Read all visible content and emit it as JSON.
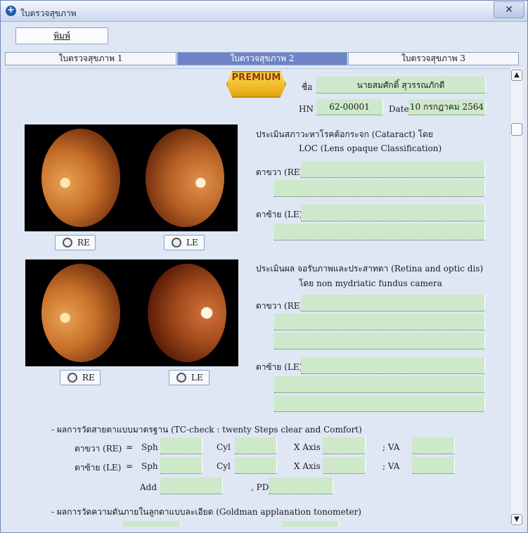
{
  "window": {
    "title": "ใบตรวจสุขภาพ",
    "close_label": "✕"
  },
  "toolbar": {
    "print_label": "พิมพ์"
  },
  "tabs": [
    {
      "label": "ใบตรวจสุขภาพ 1",
      "active": false
    },
    {
      "label": "ใบตรวจสุขภาพ 2",
      "active": true
    },
    {
      "label": "ใบตรวจสุขภาพ 3",
      "active": false
    }
  ],
  "badge": {
    "text": "PREMIUM"
  },
  "patient": {
    "name_label": "ชื่อ",
    "name": "นายสมศักดิ์ สุวรรณภักดี",
    "hn_label": "HN",
    "hn": "62-00001",
    "date_label": "Date",
    "date": "10 กรกฎาคม 2564"
  },
  "cataract": {
    "heading": "ประเมินสภาวะหาโรคต้อกระจก (Cataract) โดย",
    "subheading": "LOC (Lens opaque Classification)",
    "right_label": "ตาขวา (RE)",
    "left_label": "ตาซ้าย (LE)",
    "right_lines": [
      "",
      ""
    ],
    "left_lines": [
      "",
      ""
    ],
    "btn_re": "RE",
    "btn_le": "LE"
  },
  "retina": {
    "heading": "ประเมินผล จอรับภาพและประสาทตา (Retina and optic dis)",
    "subheading": "โดย  non mydriatic fundus camera",
    "right_label": "ตาขวา (RE)",
    "left_label": "ตาซ้าย (LE)",
    "right_lines": [
      "",
      "",
      ""
    ],
    "left_lines": [
      "",
      "",
      ""
    ],
    "btn_re": "RE",
    "btn_le": "LE"
  },
  "vision": {
    "heading": "- ผลการวัดสายตาแบบมาตรฐาน (TC-check : twenty Steps clear and Comfort)",
    "right_label": "ตาขวา (RE)",
    "left_label": "ตาซ้าย (LE)",
    "eq": "=",
    "sph": "Sph",
    "cyl": "Cyl",
    "axis": "X Axis",
    "va": "; VA",
    "add": "Add",
    "pd": ", PD"
  },
  "pressure": {
    "heading": "- ผลการวัดความดันภายในลูกตาแบบละเอียด (Goldman applanation tonometer)"
  },
  "colors": {
    "field": "#cde9c9",
    "tab_active": "#6f84c7",
    "background": "#dfe7f5"
  },
  "icons": {
    "window": "plus-circle-icon",
    "zoom": "magnifier-icon"
  }
}
